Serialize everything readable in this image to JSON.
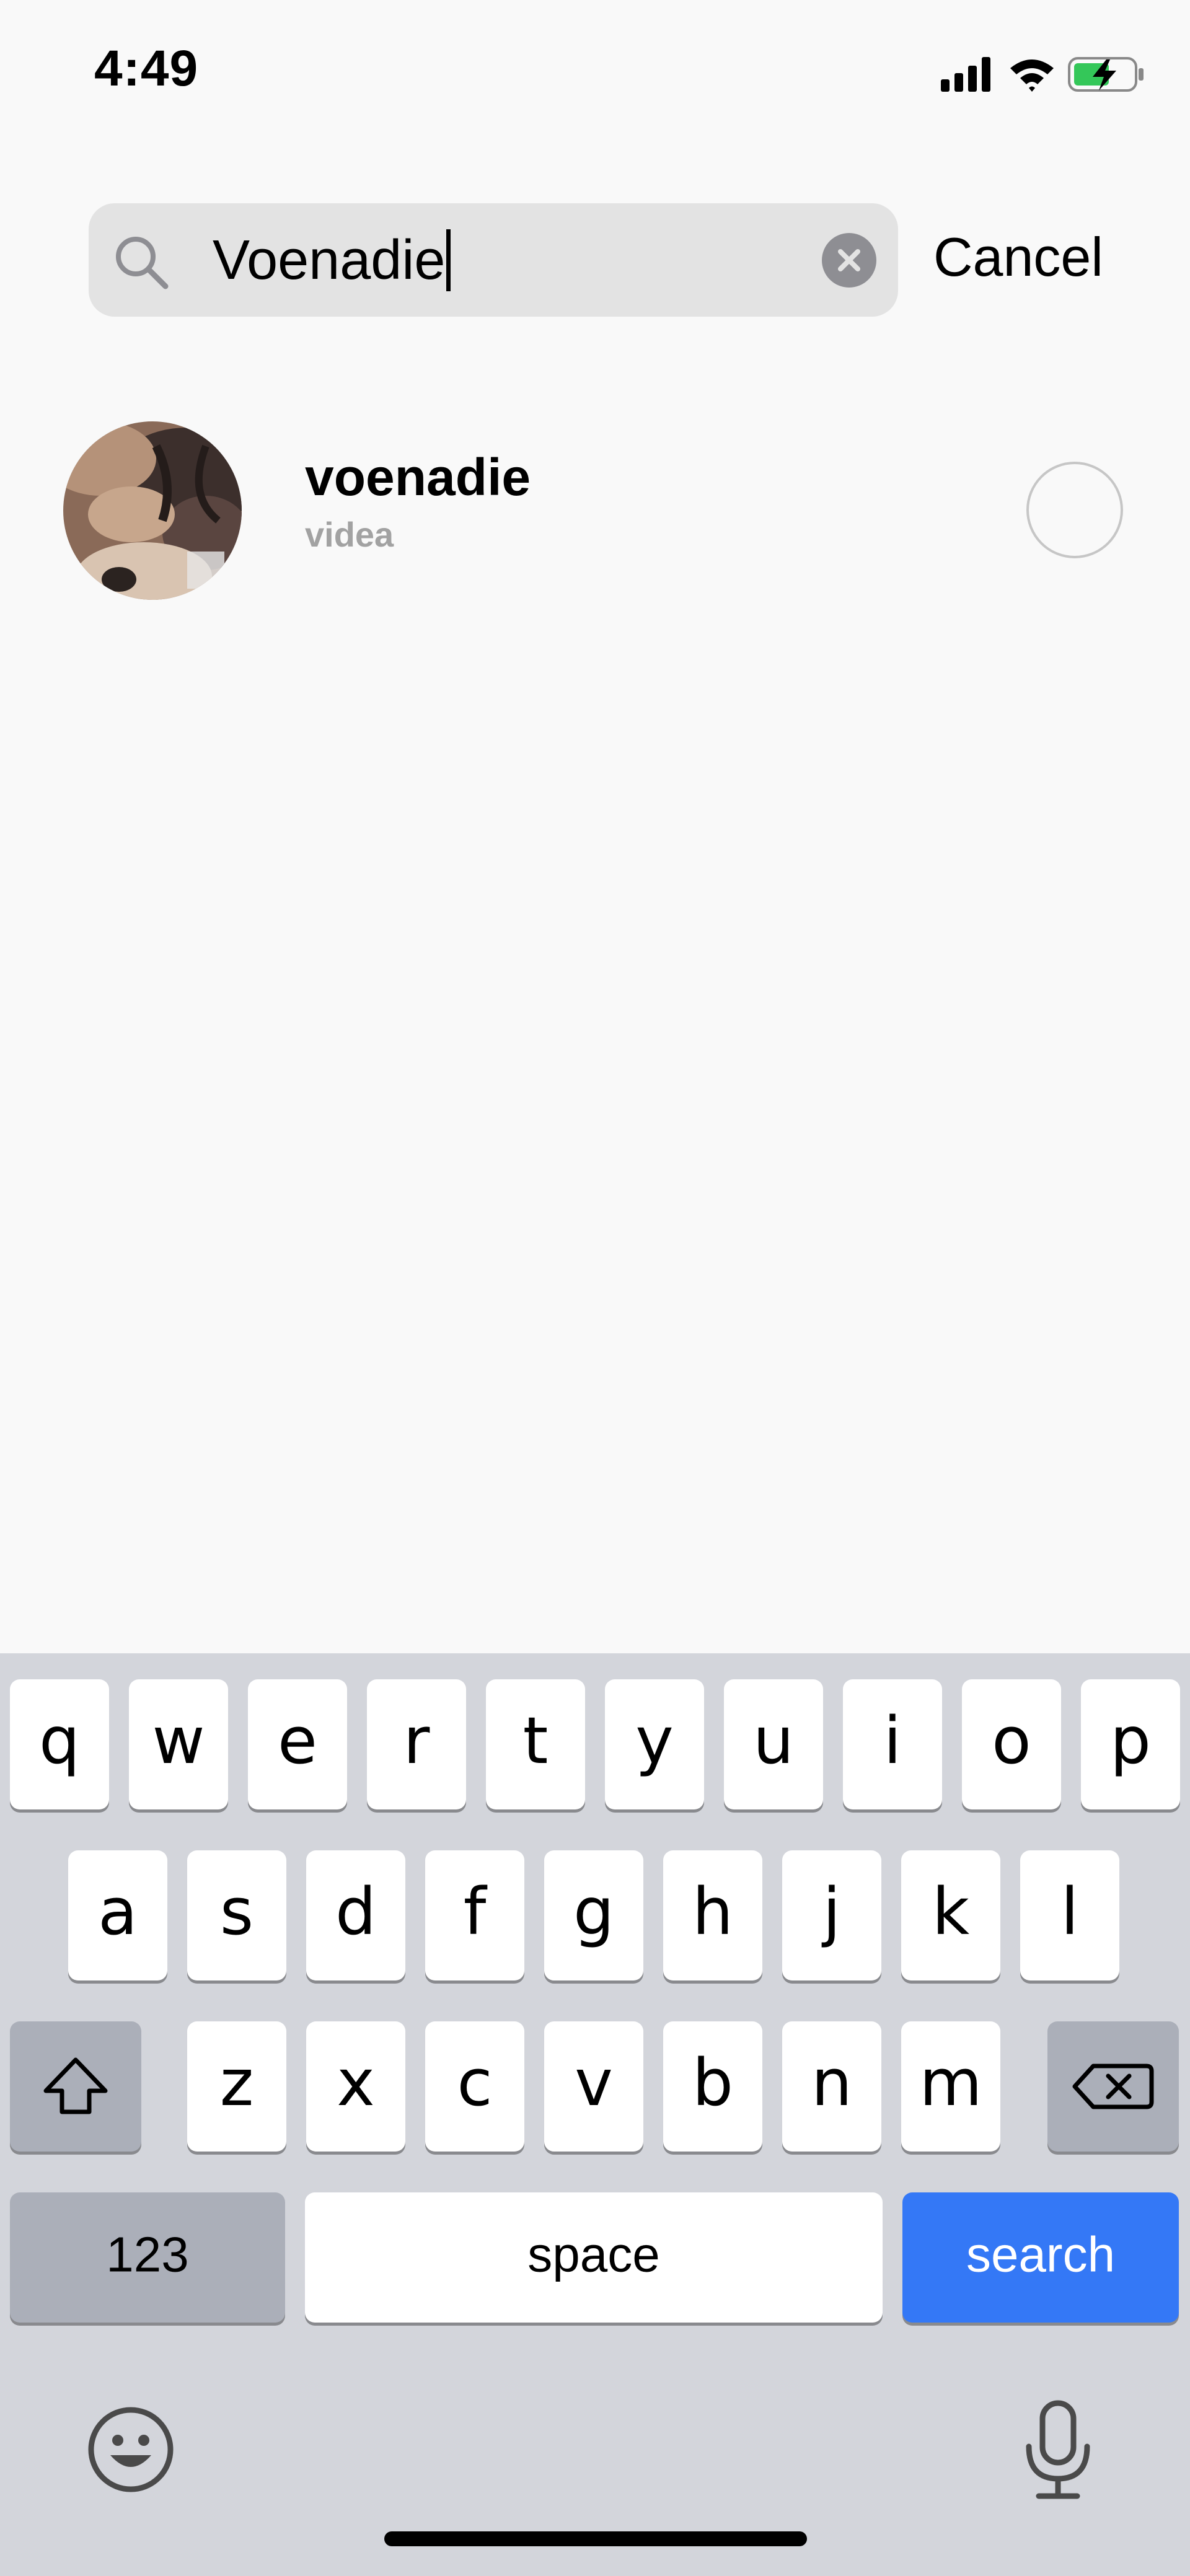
{
  "status_bar": {
    "time": "4:49",
    "signal_icon": "cellular-signal-icon",
    "wifi_icon": "wifi-icon",
    "battery_icon": "battery-charging-icon",
    "battery_color": "#34c759"
  },
  "search": {
    "value": "Voenadie",
    "search_icon": "search-icon",
    "clear_icon": "clear-icon",
    "cancel_label": "Cancel"
  },
  "results": [
    {
      "name": "voenadie",
      "subtitle": "videa",
      "avatar_icon": "avatar",
      "selected": false
    }
  ],
  "keyboard": {
    "row1": [
      "q",
      "w",
      "e",
      "r",
      "t",
      "y",
      "u",
      "i",
      "o",
      "p"
    ],
    "row2": [
      "a",
      "s",
      "d",
      "f",
      "g",
      "h",
      "j",
      "k",
      "l"
    ],
    "row3": [
      "z",
      "x",
      "c",
      "v",
      "b",
      "n",
      "m"
    ],
    "numbers_label": "123",
    "space_label": "space",
    "action_label": "search",
    "shift_icon": "shift-icon",
    "delete_icon": "backspace-icon",
    "emoji_icon": "emoji-icon",
    "mic_icon": "microphone-icon",
    "action_color": "#3478f6"
  }
}
